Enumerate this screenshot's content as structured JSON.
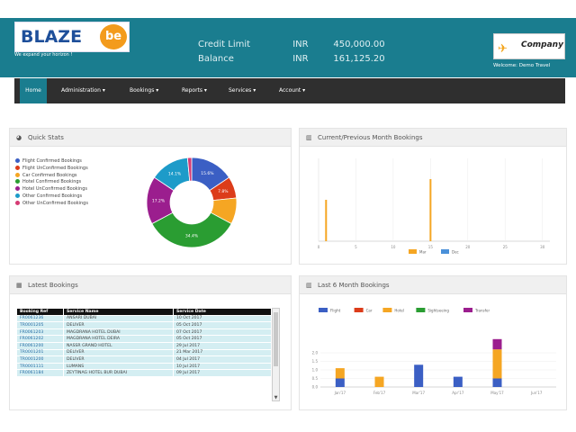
{
  "header": {
    "logo_text": "BLAZE",
    "logo_badge": "be",
    "tagline": "We expand your horizon !",
    "credit_label": "Credit Limit",
    "credit_currency": "INR",
    "credit_value": "450,000.00",
    "balance_label": "Balance",
    "balance_currency": "INR",
    "balance_value": "161,125.20",
    "company_text": "Company",
    "welcome": "Welcome: Demo Travel",
    "brand_color": "#1a7d8f"
  },
  "nav": {
    "items": [
      "Home",
      "Administration",
      "Bookings",
      "Reports",
      "Services",
      "Account"
    ]
  },
  "quick_stats": {
    "title": "Quick Stats",
    "legend": [
      {
        "label": "Flight Confirmed Bookings",
        "color": "#3b5fc4"
      },
      {
        "label": "Flight UnConfirmed Bookings",
        "color": "#dc3c1a"
      },
      {
        "label": "Car Confirmed Bookings",
        "color": "#f5a623"
      },
      {
        "label": "Hotel Confirmed Bookings",
        "color": "#2a9d32"
      },
      {
        "label": "Hotel UnConfirmed Bookings",
        "color": "#9b1e8e"
      },
      {
        "label": "Other Confirmed Bookings",
        "color": "#1d9bc9"
      },
      {
        "label": "Other UnConfirmed Bookings",
        "color": "#d63b74"
      }
    ],
    "chart_data": {
      "type": "pie",
      "labels": [
        "Flight Confirmed Bookings",
        "Flight UnConfirmed Bookings",
        "Car Confirmed Bookings",
        "Hotel Confirmed Bookings",
        "Hotel UnConfirmed Bookings",
        "Other Confirmed Bookings",
        "Other UnConfirmed Bookings"
      ],
      "values": [
        15.6,
        7.8,
        9.4,
        34.4,
        17.2,
        14.1,
        1.5
      ],
      "data_labels": [
        "15.6%",
        "7.8%",
        "",
        "34.4%",
        "17.2%",
        "14.1%",
        ""
      ],
      "colors": [
        "#3b5fc4",
        "#dc3c1a",
        "#f5a623",
        "#2a9d32",
        "#9b1e8e",
        "#1d9bc9",
        "#d63b74"
      ]
    }
  },
  "current_previous": {
    "title": "Current/Previous Month Bookings",
    "chart_data": {
      "type": "bar",
      "x_ticks": [
        "0",
        "5",
        "10",
        "15",
        "20",
        "25",
        "30"
      ],
      "xlim": [
        0,
        31
      ],
      "series": [
        {
          "name": "Mar",
          "color": "#f5a623",
          "points": [
            [
              1,
              5
            ],
            [
              15,
              7.5
            ]
          ]
        },
        {
          "name": "Dec",
          "color": "#4a90d9",
          "points": []
        }
      ],
      "ylim": [
        0,
        10
      ]
    }
  },
  "latest_bookings": {
    "title": "Latest Bookings",
    "columns": [
      "Booking Ref",
      "Service Name",
      "Service Date"
    ],
    "rows": [
      [
        "FR0061236",
        "ANSARI DUBAI",
        "10 Oct 2017"
      ],
      [
        "TR0001205",
        "DELIVER",
        "05 Oct 2017"
      ],
      [
        "FR0061203",
        "MAGDRANA HOTEL DUBAI",
        "07 Oct 2017"
      ],
      [
        "FR0061202",
        "MAGDRANA HOTEL DEIRA",
        "05 Oct 2017"
      ],
      [
        "FR0061200",
        "NASSR GRAND HOTEL",
        "29 Jul 2017"
      ],
      [
        "TR0001201",
        "DELIVER",
        "21 Mar 2017"
      ],
      [
        "TR0001200",
        "DELIVER",
        "04 Jul 2017"
      ],
      [
        "TR0001111",
        "LUMANS",
        "10 Jul 2017"
      ],
      [
        "FR0061184",
        "ZEYTINAG HOTEL BUR DUBAI",
        "09 Jul 2017"
      ]
    ]
  },
  "last_six": {
    "title": "Last 6 Month Bookings",
    "chart_data": {
      "type": "bar",
      "stacked": true,
      "categories": [
        "Jan'17",
        "Feb'17",
        "Mar'17",
        "Apr'17",
        "May'17",
        "Jun'17"
      ],
      "ylim": [
        0,
        4
      ],
      "y_ticks": [
        "0.0",
        "0.5",
        "1.0",
        "1.5",
        "2.0"
      ],
      "series": [
        {
          "name": "Flight",
          "color": "#3b5fc4",
          "values": [
            0.5,
            0,
            1.3,
            0.6,
            0.5,
            0
          ]
        },
        {
          "name": "Car",
          "color": "#dc3c1a",
          "values": [
            0,
            0,
            0,
            0,
            0,
            0
          ]
        },
        {
          "name": "Hotel",
          "color": "#f5a623",
          "values": [
            0.6,
            0.6,
            0,
            0,
            1.7,
            0
          ]
        },
        {
          "name": "Sightseeing",
          "color": "#2a9d32",
          "values": [
            0,
            0,
            0,
            0,
            0,
            0
          ]
        },
        {
          "name": "Transfer",
          "color": "#9b1e8e",
          "values": [
            0,
            0,
            0,
            0,
            0.6,
            0
          ]
        }
      ]
    }
  }
}
